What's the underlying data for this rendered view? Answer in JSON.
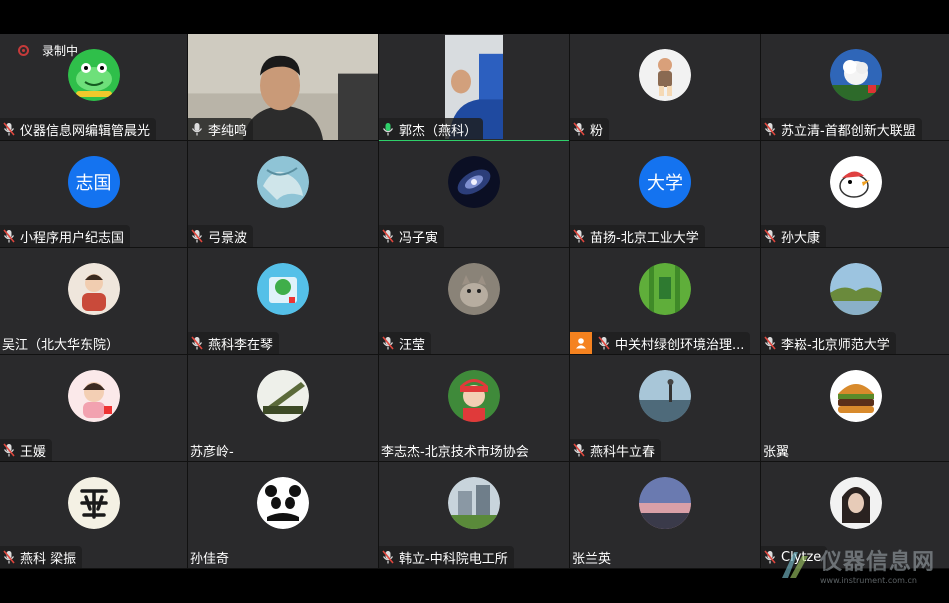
{
  "recording": {
    "label": "录制中"
  },
  "watermark": {
    "title": "仪器信息网",
    "url": "www.instrument.com.cn"
  },
  "participants": [
    {
      "name": "仪器信息网编辑管晨光",
      "mic": "muted",
      "avatar": "frog-icon"
    },
    {
      "name": "李纯鸣",
      "mic": "on",
      "avatar": "camera-feed"
    },
    {
      "name": "郭杰（燕科）",
      "mic": "speaking",
      "avatar": "camera-feed",
      "active": true
    },
    {
      "name": "粉",
      "mic": "muted",
      "avatar": "child-photo"
    },
    {
      "name": "苏立清-首都创新大联盟",
      "mic": "muted",
      "avatar": "flower-photo"
    },
    {
      "name": "小程序用户纪志国",
      "mic": "muted",
      "avatar_text": "志国"
    },
    {
      "name": "弓景波",
      "mic": "muted",
      "avatar": "map-photo"
    },
    {
      "name": "冯子寅",
      "mic": "muted",
      "avatar": "galaxy-photo"
    },
    {
      "name": "苗扬-北京工业大学",
      "mic": "muted",
      "avatar_text": "大学"
    },
    {
      "name": "孙大康",
      "mic": "muted",
      "avatar": "bird-cartoon"
    },
    {
      "name": "吴江（北大华东院）",
      "mic": "none",
      "avatar": "child-photo"
    },
    {
      "name": "燕科李在琴",
      "mic": "muted",
      "avatar": "plant-photo"
    },
    {
      "name": "汪莹",
      "mic": "muted",
      "avatar": "cat-photo"
    },
    {
      "name": "中关村绿创环境治理...",
      "mic": "muted",
      "avatar": "bamboo-photo",
      "user_badge": true
    },
    {
      "name": "李崧-北京师范大学",
      "mic": "muted",
      "avatar": "landscape-photo"
    },
    {
      "name": "王媛",
      "mic": "muted",
      "avatar": "child-photo"
    },
    {
      "name": "苏彦岭-",
      "mic": "none",
      "avatar": "missile-photo"
    },
    {
      "name": "李志杰-北京技术市场协会",
      "mic": "none",
      "avatar": "child-photo"
    },
    {
      "name": "燕科牛立春",
      "mic": "muted",
      "avatar": "city-photo"
    },
    {
      "name": "张翼",
      "mic": "none",
      "avatar": "burger-photo"
    },
    {
      "name": "燕科  梁振",
      "mic": "muted",
      "avatar": "calligraphy-icon"
    },
    {
      "name": "孙佳奇",
      "mic": "none",
      "avatar": "panda-icon"
    },
    {
      "name": "韩立-中科院电工所",
      "mic": "muted",
      "avatar": "building-photo"
    },
    {
      "name": "张兰英",
      "mic": "none",
      "avatar": "sunset-photo"
    },
    {
      "name": "Clytze",
      "mic": "muted",
      "avatar": "woman-photo"
    }
  ],
  "colors": {
    "tile_bg": "#2a2a2c",
    "avatar_blue": "#1473f0",
    "speaking_green": "#2fd06a",
    "badge_orange": "#f5821f",
    "rec_red": "#c43a3a"
  }
}
